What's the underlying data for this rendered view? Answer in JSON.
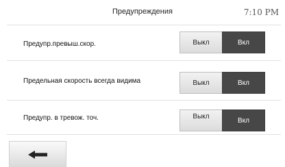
{
  "header": {
    "title": "Предупреждения",
    "clock": "7:10 PM"
  },
  "settings": [
    {
      "label": "Предупр.превыш.скор.",
      "off_label": "Выкл",
      "on_label": "Вкл",
      "selected": "on"
    },
    {
      "label": "Предельная скорость всегда видима",
      "off_label": "Выкл",
      "on_label": "Вкл",
      "selected": "on"
    },
    {
      "label": "Предупр. в тревож. точ.",
      "off_label": "Выкл",
      "on_label": "Вкл",
      "selected": "on"
    }
  ],
  "footer": {
    "back_icon": "arrow-left-icon"
  },
  "colors": {
    "selected_segment": "#474747",
    "unselected_segment": "#e6e6e6",
    "divider": "#e0e0e0"
  }
}
